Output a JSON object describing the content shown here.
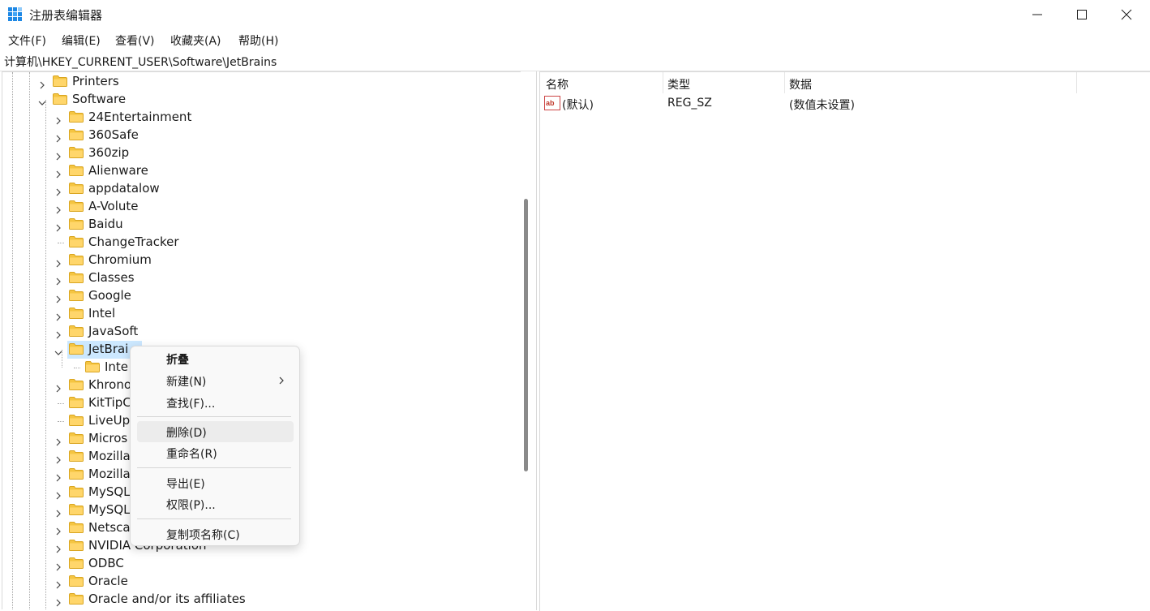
{
  "window": {
    "title": "注册表编辑器",
    "app_icon": "registry-editor-icon",
    "controls": [
      "minimize-icon",
      "maximize-icon",
      "close-icon"
    ]
  },
  "menubar": {
    "items": [
      "文件(F)",
      "编辑(E)",
      "查看(V)",
      "收藏夹(A)",
      "帮助(H)"
    ]
  },
  "address": "计算机\\HKEY_CURRENT_USER\\Software\\JetBrains",
  "tree": {
    "nodes": [
      {
        "label": "Printers",
        "level": 1,
        "expander": "collapsed"
      },
      {
        "label": "Software",
        "level": 1,
        "expander": "expanded"
      },
      {
        "label": "24Entertainment",
        "level": 2,
        "expander": "collapsed"
      },
      {
        "label": "360Safe",
        "level": 2,
        "expander": "collapsed"
      },
      {
        "label": "360zip",
        "level": 2,
        "expander": "collapsed"
      },
      {
        "label": "Alienware",
        "level": 2,
        "expander": "collapsed"
      },
      {
        "label": "appdatalow",
        "level": 2,
        "expander": "collapsed"
      },
      {
        "label": "A-Volute",
        "level": 2,
        "expander": "collapsed"
      },
      {
        "label": "Baidu",
        "level": 2,
        "expander": "collapsed"
      },
      {
        "label": "ChangeTracker",
        "level": 2,
        "expander": "none"
      },
      {
        "label": "Chromium",
        "level": 2,
        "expander": "collapsed"
      },
      {
        "label": "Classes",
        "level": 2,
        "expander": "collapsed"
      },
      {
        "label": "Google",
        "level": 2,
        "expander": "collapsed"
      },
      {
        "label": "Intel",
        "level": 2,
        "expander": "collapsed"
      },
      {
        "label": "JavaSoft",
        "level": 2,
        "expander": "collapsed"
      },
      {
        "label": "JetBrai",
        "level": 2,
        "expander": "expanded",
        "selected": true
      },
      {
        "label": "Inte",
        "level": 3,
        "expander": "none"
      },
      {
        "label": "Khrono",
        "level": 2,
        "expander": "collapsed"
      },
      {
        "label": "KitTipC",
        "level": 2,
        "expander": "none"
      },
      {
        "label": "LiveUp",
        "level": 2,
        "expander": "none"
      },
      {
        "label": "Micros",
        "level": 2,
        "expander": "collapsed"
      },
      {
        "label": "Mozilla",
        "level": 2,
        "expander": "collapsed"
      },
      {
        "label": "Mozilla",
        "level": 2,
        "expander": "collapsed"
      },
      {
        "label": "MySQL",
        "level": 2,
        "expander": "collapsed"
      },
      {
        "label": "MySQL",
        "level": 2,
        "expander": "collapsed"
      },
      {
        "label": "Netsca",
        "level": 2,
        "expander": "collapsed"
      },
      {
        "label": "NVIDIA Corporation",
        "level": 2,
        "expander": "collapsed"
      },
      {
        "label": "ODBC",
        "level": 2,
        "expander": "collapsed"
      },
      {
        "label": "Oracle",
        "level": 2,
        "expander": "collapsed"
      },
      {
        "label": "Oracle and/or its affiliates",
        "level": 2,
        "expander": "collapsed"
      }
    ]
  },
  "values_pane": {
    "columns": [
      "名称",
      "类型",
      "数据"
    ],
    "rows": [
      {
        "icon": "string-value-icon",
        "name": "(默认)",
        "type": "REG_SZ",
        "data": "(数值未设置)"
      }
    ]
  },
  "context_menu": {
    "items": [
      {
        "label": "折叠",
        "bold": true
      },
      {
        "label": "新建(N)",
        "submenu": true
      },
      {
        "label": "查找(F)..."
      },
      {
        "separator": true
      },
      {
        "label": "删除(D)",
        "hover": true
      },
      {
        "label": "重命名(R)"
      },
      {
        "separator": true
      },
      {
        "label": "导出(E)"
      },
      {
        "label": "权限(P)..."
      },
      {
        "separator": true
      },
      {
        "label": "复制项名称(C)"
      }
    ]
  },
  "colors": {
    "selection": "#cce8ff",
    "folder": "#f5c542",
    "menu_hover": "#ececec"
  }
}
